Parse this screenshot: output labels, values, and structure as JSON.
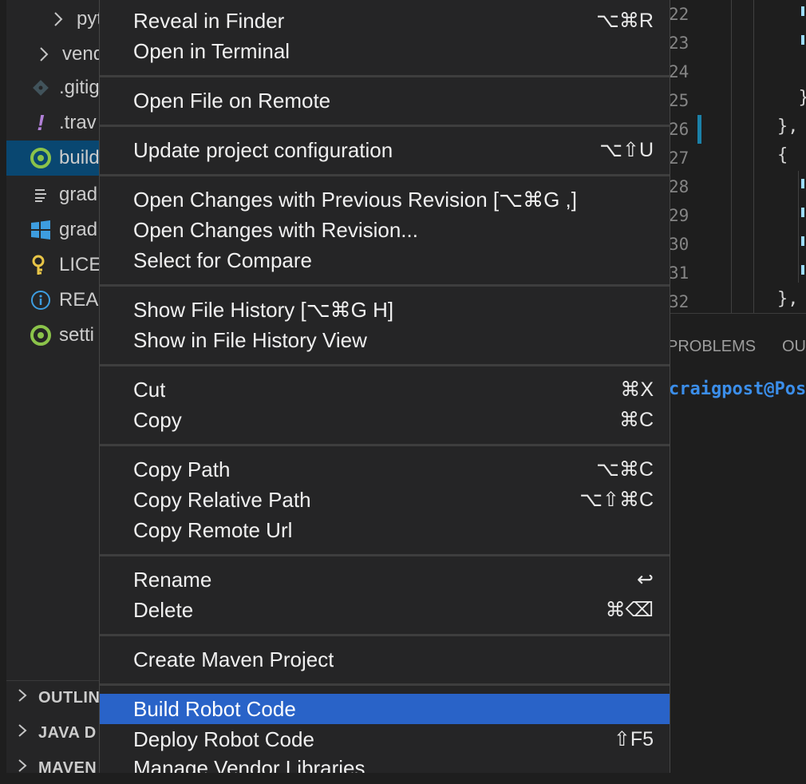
{
  "explorer": {
    "items": [
      {
        "label": "pyt",
        "icon": "chevron-right-icon"
      },
      {
        "label": "vend",
        "icon": "chevron-right-icon"
      },
      {
        "label": ".gitig",
        "icon": "git-icon"
      },
      {
        "label": ".trav",
        "icon": "exclamation-icon"
      },
      {
        "label": "build",
        "icon": "gradle-icon"
      },
      {
        "label": "grad",
        "icon": "lines-icon"
      },
      {
        "label": "grad",
        "icon": "windows-icon"
      },
      {
        "label": "LICE",
        "icon": "key-icon"
      },
      {
        "label": "REA",
        "icon": "info-icon"
      },
      {
        "label": "setti",
        "icon": "gradle-icon"
      }
    ],
    "sections": [
      "OUTLINE",
      "JAVA D",
      "MAVEN"
    ]
  },
  "editor": {
    "line_numbers": [
      "22",
      "23",
      "24",
      "25",
      "26",
      "27",
      "28",
      "29",
      "30",
      "31",
      "32"
    ],
    "code_lines": [
      "",
      "",
      "",
      "  }",
      "},",
      "{",
      "",
      "",
      "",
      "",
      "},"
    ]
  },
  "panel": {
    "tabs": [
      "PROBLEMS",
      "OU"
    ],
    "terminal_text": "craigpost@Post"
  },
  "context_menu": {
    "groups": [
      [
        {
          "label": "Reveal in Finder",
          "shortcut": "⌥⌘R"
        },
        {
          "label": "Open in Terminal",
          "shortcut": ""
        }
      ],
      [
        {
          "label": "Open File on Remote",
          "shortcut": ""
        }
      ],
      [
        {
          "label": "Update project configuration",
          "shortcut": "⌥⇧U"
        }
      ],
      [
        {
          "label": "Open Changes with Previous Revision [⌥⌘G ,]",
          "shortcut": ""
        },
        {
          "label": "Open Changes with Revision...",
          "shortcut": ""
        },
        {
          "label": "Select for Compare",
          "shortcut": ""
        }
      ],
      [
        {
          "label": "Show File History [⌥⌘G H]",
          "shortcut": ""
        },
        {
          "label": "Show in File History View",
          "shortcut": ""
        }
      ],
      [
        {
          "label": "Cut",
          "shortcut": "⌘X"
        },
        {
          "label": "Copy",
          "shortcut": "⌘C"
        }
      ],
      [
        {
          "label": "Copy Path",
          "shortcut": "⌥⌘C"
        },
        {
          "label": "Copy Relative Path",
          "shortcut": "⌥⇧⌘C"
        },
        {
          "label": "Copy Remote Url",
          "shortcut": ""
        }
      ],
      [
        {
          "label": "Rename",
          "shortcut": "↩"
        },
        {
          "label": "Delete",
          "shortcut": "⌘⌫"
        }
      ],
      [
        {
          "label": "Create Maven Project",
          "shortcut": ""
        }
      ],
      [
        {
          "label": "Build Robot Code",
          "shortcut": "",
          "highlighted": true
        },
        {
          "label": "Deploy Robot Code",
          "shortcut": "⇧F5"
        },
        {
          "label": "Manage Vendor Libraries",
          "shortcut": ""
        }
      ]
    ]
  },
  "colors": {
    "menu_background": "#252526",
    "menu_highlight": "#2963c8",
    "sidebar_selected": "#094771",
    "gradle_green": "#8bc34a"
  }
}
